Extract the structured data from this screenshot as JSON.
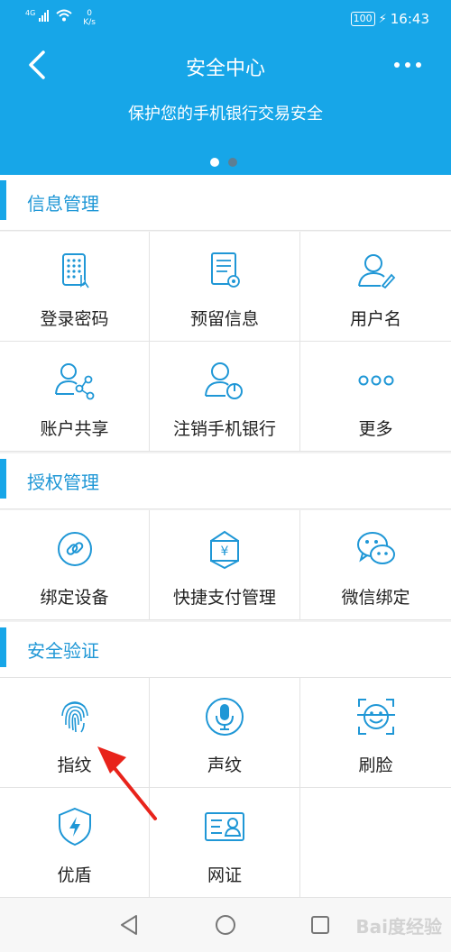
{
  "status_bar": {
    "network": "4G",
    "speed_value": "0",
    "speed_unit": "K/s",
    "battery": "100",
    "time": "16:43"
  },
  "header": {
    "title": "安全中心",
    "subtitle": "保护您的手机银行交易安全",
    "accent_color": "#17a6e8"
  },
  "sections": [
    {
      "title": "信息管理",
      "items": [
        {
          "label": "登录密码",
          "icon": "keypad-icon"
        },
        {
          "label": "预留信息",
          "icon": "document-gear-icon"
        },
        {
          "label": "用户名",
          "icon": "user-edit-icon"
        },
        {
          "label": "账户共享",
          "icon": "user-share-icon"
        },
        {
          "label": "注销手机银行",
          "icon": "user-power-icon"
        },
        {
          "label": "更多",
          "icon": "more-dots-icon"
        }
      ]
    },
    {
      "title": "授权管理",
      "items": [
        {
          "label": "绑定设备",
          "icon": "link-icon"
        },
        {
          "label": "快捷支付管理",
          "icon": "yuan-payment-icon"
        },
        {
          "label": "微信绑定",
          "icon": "wechat-icon"
        }
      ]
    },
    {
      "title": "安全验证",
      "items": [
        {
          "label": "指纹",
          "icon": "fingerprint-icon"
        },
        {
          "label": "声纹",
          "icon": "microphone-icon"
        },
        {
          "label": "刷脸",
          "icon": "face-scan-icon"
        },
        {
          "label": "优盾",
          "icon": "shield-bolt-icon"
        },
        {
          "label": "网证",
          "icon": "id-card-icon"
        }
      ]
    }
  ],
  "watermark": "Bai度经验"
}
